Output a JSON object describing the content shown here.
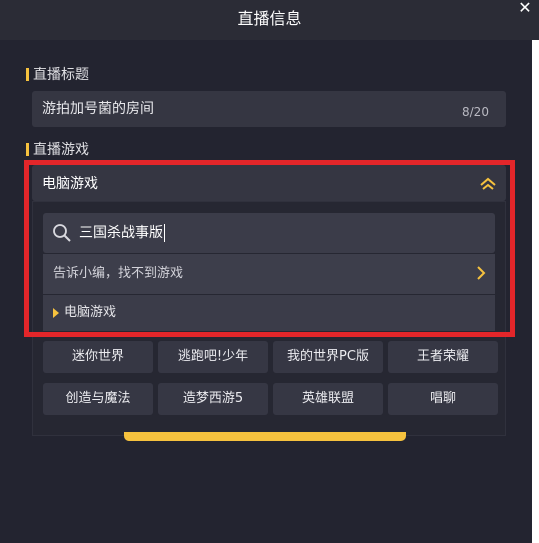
{
  "window": {
    "title": "直播信息"
  },
  "live_title": {
    "section_label": "直播标题",
    "value": "游拍加号菌的房间",
    "counter": "8/20"
  },
  "live_game": {
    "section_label": "直播游戏",
    "selected": "电脑游戏"
  },
  "dropdown": {
    "search_value": "三国杀战事版",
    "feedback_link": "告诉小编，找不到游戏",
    "category": "电脑游戏",
    "games": [
      "迷你世界",
      "逃跑吧!少年",
      "我的世界PC版",
      "王者荣耀",
      "创造与魔法",
      "造梦西游5",
      "英雄联盟",
      "唱聊"
    ]
  },
  "colors": {
    "accent": "#f6c23e",
    "highlight_frame": "#e3262a",
    "background": "#1d1e27"
  },
  "icons": [
    "close-icon",
    "chevron-up-icon",
    "search-icon",
    "chevron-right-icon",
    "triangle-right-icon"
  ]
}
